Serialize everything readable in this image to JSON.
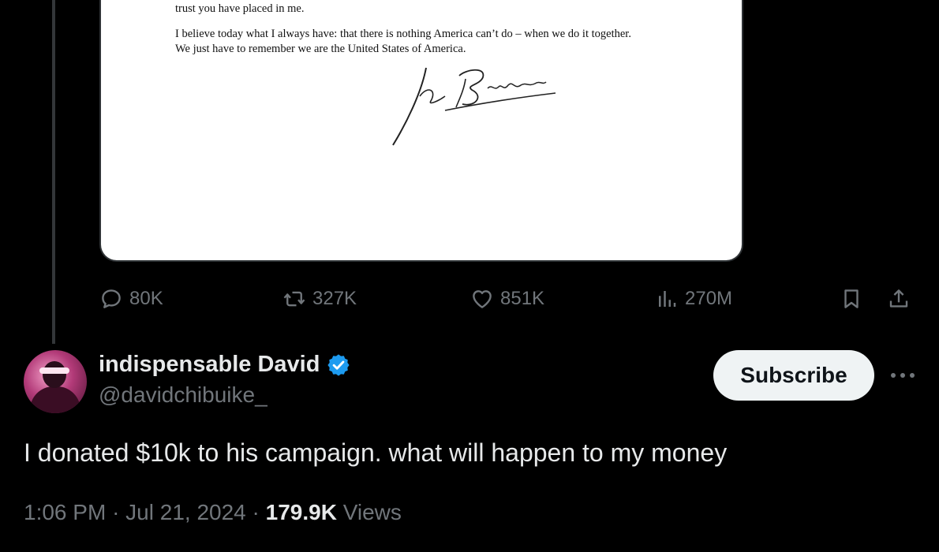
{
  "media": {
    "letter_line_1": "trust you have placed in me.",
    "letter_paragraph_2": "I believe today what I always have: that there is nothing America can’t do – when we do it together. We just have to remember we are the United States of America.",
    "signature_text": "Joe Biden"
  },
  "actions": {
    "replies": "80K",
    "reposts": "327K",
    "likes": "851K",
    "views": "270M"
  },
  "reply": {
    "display_name": "indispensable David",
    "handle": "@davidchibuike_",
    "subscribe_label": "Subscribe",
    "text": "I donated $10k to his campaign. what will happen to my money",
    "time": "1:06 PM",
    "separator": "·",
    "date": "Jul 21, 2024",
    "views_count": "179.9K",
    "views_label": "Views"
  },
  "colors": {
    "background": "#000000",
    "text_primary": "#e7e9ea",
    "text_secondary": "#71767b",
    "verified_blue": "#1d9bf0",
    "button_bg": "#eff3f4"
  }
}
